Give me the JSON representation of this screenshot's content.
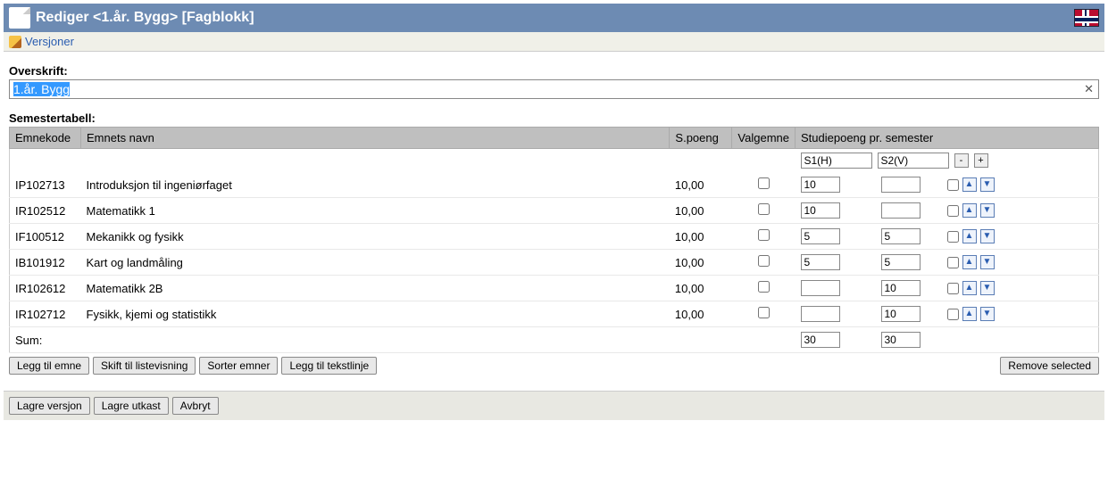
{
  "header": {
    "title": "Rediger <1.år. Bygg> [Fagblokk]",
    "flag": "no"
  },
  "toolbar": {
    "versions_label": "Versjoner"
  },
  "labels": {
    "overskrift": "Overskrift:",
    "semestertabell": "Semestertabell:",
    "sum": "Sum:"
  },
  "title_input": {
    "value": "1.år. Bygg",
    "selected": true
  },
  "columns": {
    "code": "Emnekode",
    "name": "Emnets navn",
    "sp": "S.poeng",
    "valg": "Valgemne",
    "sem": "Studiepoeng pr. semester"
  },
  "semesters": [
    "S1(H)",
    "S2(V)"
  ],
  "pm": {
    "minus": "-",
    "plus": "+"
  },
  "rows": [
    {
      "code": "IP102713",
      "name": "Introduksjon til ingeniørfaget",
      "sp": "10,00",
      "valg": false,
      "sv": [
        "10",
        ""
      ],
      "sel": false
    },
    {
      "code": "IR102512",
      "name": "Matematikk 1",
      "sp": "10,00",
      "valg": false,
      "sv": [
        "10",
        ""
      ],
      "sel": false
    },
    {
      "code": "IF100512",
      "name": "Mekanikk og fysikk",
      "sp": "10,00",
      "valg": false,
      "sv": [
        "5",
        "5"
      ],
      "sel": false
    },
    {
      "code": "IB101912",
      "name": "Kart og landmåling",
      "sp": "10,00",
      "valg": false,
      "sv": [
        "5",
        "5"
      ],
      "sel": false
    },
    {
      "code": "IR102612",
      "name": "Matematikk 2B",
      "sp": "10,00",
      "valg": false,
      "sv": [
        "",
        "10"
      ],
      "sel": false
    },
    {
      "code": "IR102712",
      "name": "Fysikk, kjemi og statistikk",
      "sp": "10,00",
      "valg": false,
      "sv": [
        "",
        "10"
      ],
      "sel": false
    }
  ],
  "sums": [
    "30",
    "30"
  ],
  "buttons": {
    "add_emne": "Legg til emne",
    "list_view": "Skift til listevisning",
    "sort": "Sorter emner",
    "add_text": "Legg til tekstlinje",
    "remove_sel": "Remove selected",
    "save_ver": "Lagre versjon",
    "save_draft": "Lagre utkast",
    "cancel": "Avbryt"
  }
}
